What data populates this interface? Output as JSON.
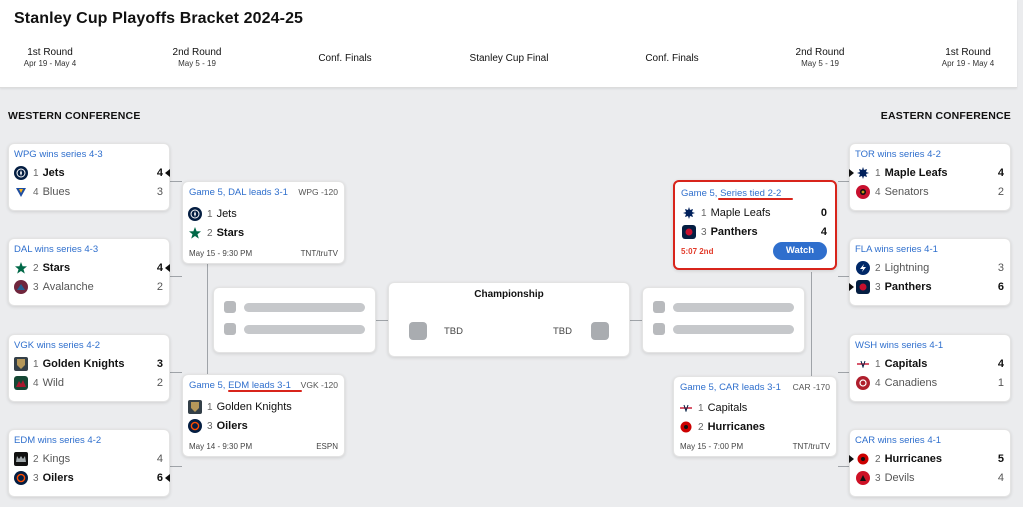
{
  "title": "Stanley Cup Playoffs Bracket 2024-25",
  "rounds": [
    {
      "name": "1st Round",
      "dates": "Apr 19 - May 4"
    },
    {
      "name": "2nd Round",
      "dates": "May 5 - 19"
    },
    {
      "name": "Conf. Finals",
      "dates": ""
    },
    {
      "name": "Stanley Cup Final",
      "dates": ""
    },
    {
      "name": "Conf. Finals",
      "dates": ""
    },
    {
      "name": "2nd Round",
      "dates": "May 5 - 19"
    },
    {
      "name": "1st Round",
      "dates": "Apr 19 - May 4"
    }
  ],
  "west_label": "WESTERN CONFERENCE",
  "east_label": "EASTERN CONFERENCE",
  "west_r1": [
    {
      "headline": "WPG wins series 4-3",
      "teams": [
        {
          "seed": "1",
          "name": "Jets",
          "score": "4"
        },
        {
          "seed": "4",
          "name": "Blues",
          "score": "3"
        }
      ]
    },
    {
      "headline": "DAL wins series 4-3",
      "teams": [
        {
          "seed": "2",
          "name": "Stars",
          "score": "4"
        },
        {
          "seed": "3",
          "name": "Avalanche",
          "score": "2"
        }
      ]
    },
    {
      "headline": "VGK wins series 4-2",
      "teams": [
        {
          "seed": "1",
          "name": "Golden Knights",
          "score": "3"
        },
        {
          "seed": "4",
          "name": "Wild",
          "score": "2"
        }
      ]
    },
    {
      "headline": "EDM wins series 4-2",
      "teams": [
        {
          "seed": "2",
          "name": "Kings",
          "score": "4"
        },
        {
          "seed": "3",
          "name": "Oilers",
          "score": "6"
        }
      ]
    }
  ],
  "east_r1": [
    {
      "headline": "TOR wins series 4-2",
      "teams": [
        {
          "seed": "1",
          "name": "Maple Leafs",
          "score": "4"
        },
        {
          "seed": "4",
          "name": "Senators",
          "score": "2"
        }
      ]
    },
    {
      "headline": "FLA wins series 4-1",
      "teams": [
        {
          "seed": "2",
          "name": "Lightning",
          "score": "3"
        },
        {
          "seed": "3",
          "name": "Panthers",
          "score": "6"
        }
      ]
    },
    {
      "headline": "WSH wins series 4-1",
      "teams": [
        {
          "seed": "1",
          "name": "Capitals",
          "score": "4"
        },
        {
          "seed": "4",
          "name": "Canadiens",
          "score": "1"
        }
      ]
    },
    {
      "headline": "CAR wins series 4-1",
      "teams": [
        {
          "seed": "2",
          "name": "Hurricanes",
          "score": "5"
        },
        {
          "seed": "3",
          "name": "Devils",
          "score": "4"
        }
      ]
    }
  ],
  "west_r2": [
    {
      "headline": "Game 5, DAL leads 3-1",
      "odds": "WPG -120",
      "teams": [
        {
          "seed": "1",
          "name": "Jets"
        },
        {
          "seed": "2",
          "name": "Stars"
        }
      ],
      "time": "May 15 - 9:30 PM",
      "network": "TNT/truTV"
    },
    {
      "headline": "Game 5, EDM leads 3-1",
      "odds": "VGK -120",
      "teams": [
        {
          "seed": "1",
          "name": "Golden Knights"
        },
        {
          "seed": "3",
          "name": "Oilers"
        }
      ],
      "time": "May 14 - 9:30 PM",
      "network": "ESPN"
    }
  ],
  "east_r2": [
    {
      "headline": "Game 5, Series tied 2-2",
      "teams": [
        {
          "seed": "1",
          "name": "Maple Leafs",
          "score": "0"
        },
        {
          "seed": "3",
          "name": "Panthers",
          "score": "4"
        }
      ],
      "live": "5:07 2nd",
      "watch": "Watch"
    },
    {
      "headline": "Game 5, CAR leads 3-1",
      "odds": "CAR -170",
      "teams": [
        {
          "seed": "1",
          "name": "Capitals"
        },
        {
          "seed": "2",
          "name": "Hurricanes"
        }
      ],
      "time": "May 15 - 7:00 PM",
      "network": "TNT/truTV"
    }
  ],
  "championship": {
    "title": "Championship",
    "left": "TBD",
    "right": "TBD"
  },
  "colors": {
    "link": "#2f6fcd",
    "live": "#e23b2a",
    "highlight_border": "#d8241b",
    "button": "#2f6fcd"
  }
}
